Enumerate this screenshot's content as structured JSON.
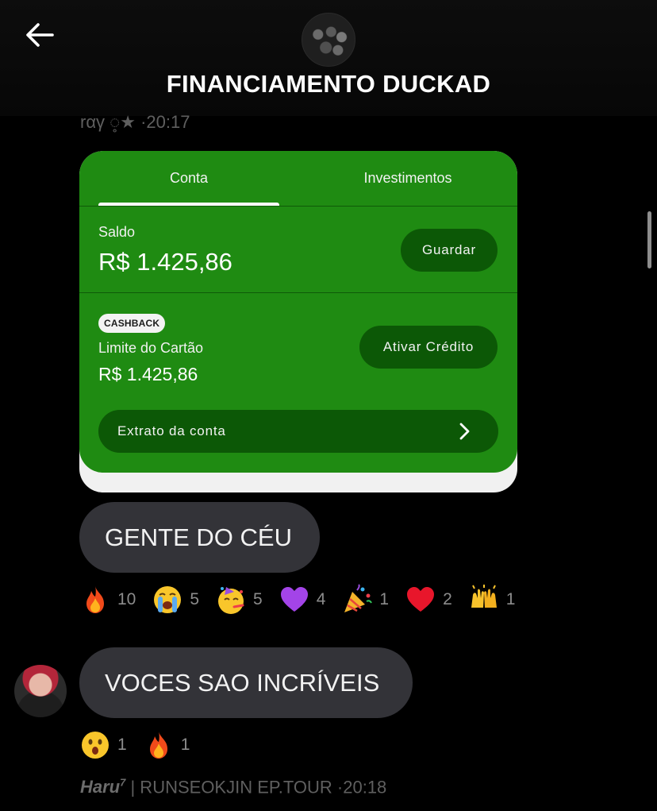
{
  "header": {
    "title": "FINANCIAMENTO DUCKAD",
    "back_icon": "arrow-left-icon",
    "avatar_icon": "group-avatar"
  },
  "message_top_meta": {
    "author": "rαγ ◌̥★",
    "time": "·20:17"
  },
  "bank_card": {
    "tabs": [
      {
        "label": "Conta",
        "selected": true
      },
      {
        "label": "Investimentos",
        "selected": false
      }
    ],
    "saldo_label": "Saldo",
    "saldo_value": "R$ 1.425,86",
    "guardar_label": "Guardar",
    "cashback_badge": "CASHBACK",
    "limite_label": "Limite do Cartão",
    "limite_value": "R$ 1.425,86",
    "ativar_credito_label": "Ativar Crédito",
    "extrato_label": "Extrato da conta",
    "colors": {
      "card_green": "#1f8b12",
      "button_green": "#0c5806"
    }
  },
  "messages": [
    {
      "text": "GENTE DO CÉU",
      "reactions": [
        {
          "icon": "fire-icon",
          "emoji": "🔥",
          "count": "10"
        },
        {
          "icon": "loudly-crying-face-icon",
          "emoji": "😭",
          "count": "5"
        },
        {
          "icon": "partying-face-icon",
          "emoji": "🥳",
          "count": "5"
        },
        {
          "icon": "purple-heart-icon",
          "emoji": "💜",
          "count": "4"
        },
        {
          "icon": "party-popper-icon",
          "emoji": "🎉",
          "count": "1"
        },
        {
          "icon": "red-heart-icon",
          "emoji": "❤️",
          "count": "2"
        },
        {
          "icon": "raising-hands-icon",
          "emoji": "🙌",
          "count": "1"
        }
      ]
    },
    {
      "text": "VOCES SAO INCRÍVEIS",
      "reactions": [
        {
          "icon": "astonished-face-icon",
          "emoji": "😲",
          "count": "1"
        },
        {
          "icon": "fire-icon",
          "emoji": "🔥",
          "count": "1"
        }
      ]
    }
  ],
  "message_bottom_meta": {
    "author": "Haru",
    "author_sup": "7",
    "subtitle": "| RUNSEOKJIN EP.TOUR",
    "time": "·20:18"
  }
}
